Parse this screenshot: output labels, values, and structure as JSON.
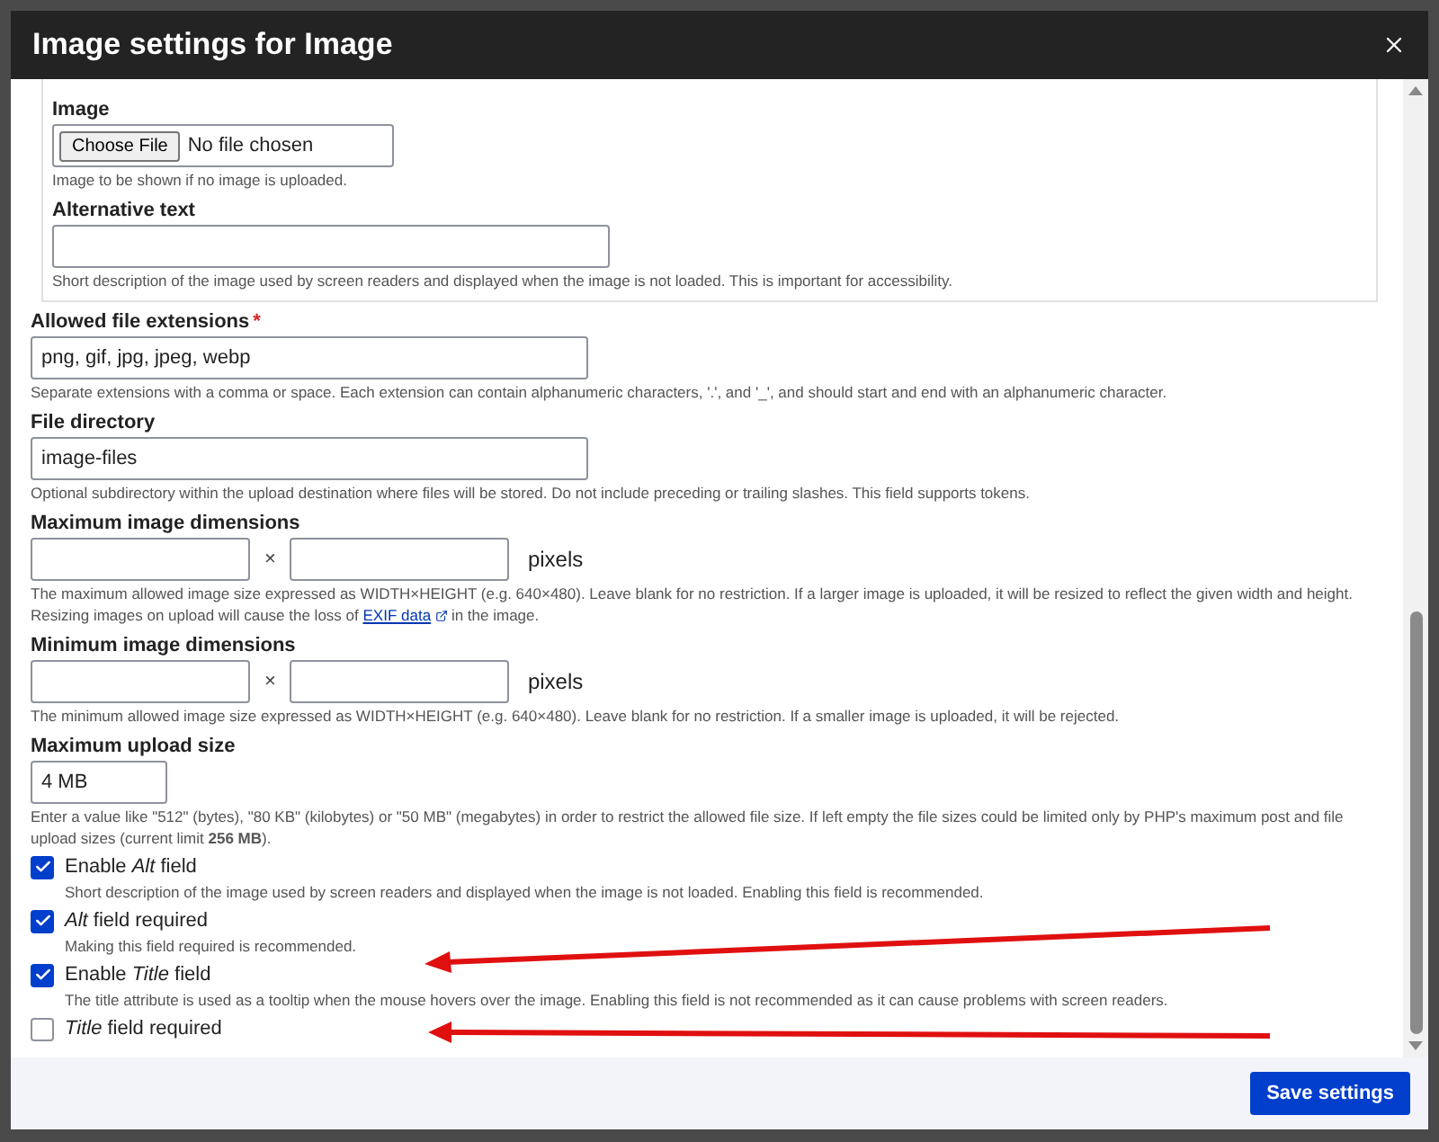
{
  "dialog": {
    "title": "Image settings for Image"
  },
  "default_image": {
    "image_label": "Image",
    "file_button": "Choose File",
    "file_status": "No file chosen",
    "image_description": "Image to be shown if no image is uploaded.",
    "alt_label": "Alternative text",
    "alt_description": "Short description of the image used by screen readers and displayed when the image is not loaded. This is important for accessibility."
  },
  "fields": [
    {
      "kind": "text",
      "label": "Allowed file extensions",
      "required_mark": "*",
      "value": "png, gif, jpg, jpeg, webp",
      "description": "Separate extensions with a comma or space. Each extension can contain alphanumeric characters, '.', and '_', and should start and end with an alphanumeric character."
    },
    {
      "kind": "text",
      "label": "File directory",
      "value": "image-files",
      "description": "Optional subdirectory within the upload destination where files will be stored. Do not include preceding or trailing slashes. This field supports tokens."
    },
    {
      "kind": "dimensions",
      "label": "Maximum image dimensions",
      "separator": "×",
      "unit": "pixels",
      "description": "The maximum allowed image size expressed as WIDTH×HEIGHT (e.g. 640×480). Leave blank for no restriction. If a larger image is uploaded, it will be resized to reflect the given width and height. Resizing images on upload will cause the loss of",
      "link": "EXIF data",
      "description_end": "in the image."
    },
    {
      "kind": "dimensions",
      "label": "Minimum image dimensions",
      "separator": "×",
      "unit": "pixels",
      "description": "The minimum allowed image size expressed as WIDTH×HEIGHT (e.g. 640×480). Leave blank for no restriction. If a smaller image is uploaded, it will be rejected."
    },
    {
      "kind": "size",
      "label": "Maximum upload size",
      "value": "4 MB",
      "description": "Enter a value like \"512\" (bytes), \"80 KB\" (kilobytes) or \"50 MB\" (megabytes) in order to restrict the allowed file size. If left empty the file sizes could be limited only by PHP's maximum post and file upload sizes (current limit **256 MB**)."
    },
    {
      "kind": "checkbox",
      "label": "Enable *Alt* field",
      "checked": true,
      "description": "Short description of the image used by screen readers and displayed when the image is not loaded. Enabling this field is recommended."
    },
    {
      "kind": "checkbox",
      "label": "*Alt* field required",
      "checked": true,
      "description": "Making this field required is recommended."
    },
    {
      "kind": "checkbox",
      "label": "Enable *Title* field",
      "checked": true,
      "description": "The title attribute is used as a tooltip when the mouse hovers over the image. Enabling this field is not recommended as it can cause problems with screen readers."
    },
    {
      "kind": "checkbox",
      "label": "*Title* field required",
      "checked": false
    }
  ],
  "footer": {
    "save_button": "Save settings"
  }
}
